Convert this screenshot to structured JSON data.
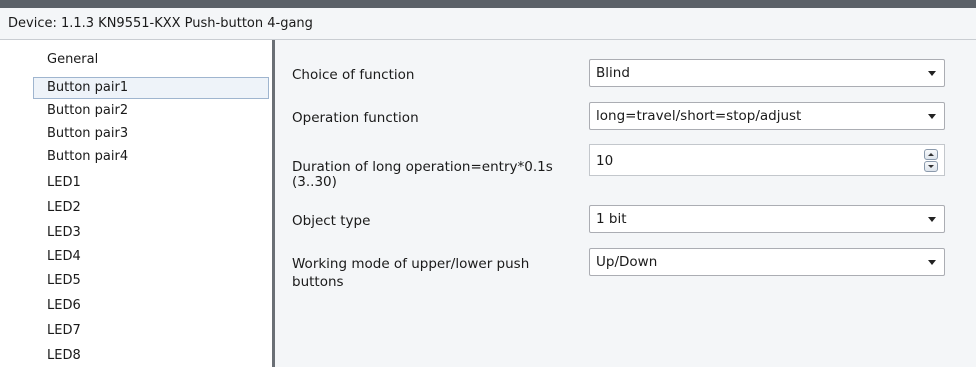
{
  "window": {
    "title": "Device: 1.1.3  KN9551-KXX Push-button 4-gang"
  },
  "sidebar": {
    "items": [
      {
        "label": "General"
      },
      {
        "label": "Button pair1",
        "selected": true
      },
      {
        "label": "Button pair2"
      },
      {
        "label": "Button pair3"
      },
      {
        "label": "Button pair4"
      },
      {
        "label": "LED1"
      },
      {
        "label": "LED2"
      },
      {
        "label": "LED3"
      },
      {
        "label": "LED4"
      },
      {
        "label": "LED5"
      },
      {
        "label": "LED6"
      },
      {
        "label": "LED7"
      },
      {
        "label": "LED8"
      }
    ]
  },
  "params": {
    "choice_of_function": {
      "label": "Choice of function",
      "value": "Blind"
    },
    "operation_function": {
      "label": "Operation function",
      "value": "long=travel/short=stop/adjust"
    },
    "long_operation": {
      "label_line1": "Duration of long operation=entry*0.1s",
      "label_line2": "(3..30)",
      "value": "10"
    },
    "object_type": {
      "label": "Object type",
      "value": "1 bit"
    },
    "working_mode": {
      "label_line1": "Working mode of upper/lower push",
      "label_line2": "buttons",
      "value": "Up/Down"
    }
  },
  "colors": {
    "top_bar": "#5b6168",
    "panel_background": "#f4f6f8",
    "selection_border": "#9fb5cf",
    "divider": "#6a6f75"
  }
}
